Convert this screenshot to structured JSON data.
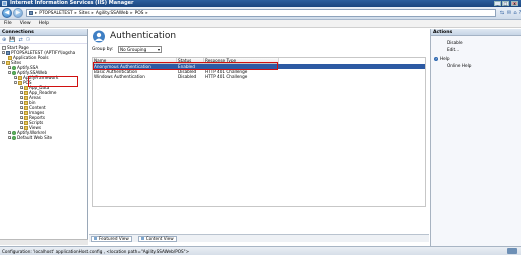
{
  "window": {
    "title": "Internet Information Services (IIS) Manager"
  },
  "window_controls": {
    "minimize": "_",
    "maximize": "□",
    "close": "x"
  },
  "nav": {
    "back": "◀",
    "forward": "▶",
    "breadcrumbs": [
      "PTOPSALETEST",
      "Sites",
      "Agility.SSAWeb",
      "POS"
    ],
    "separator": "▸",
    "tools": [
      "⇆",
      "✉",
      "⌂",
      "?"
    ]
  },
  "menu": [
    "File",
    "View",
    "Help"
  ],
  "connections": {
    "header": "Connections",
    "toolbar": [
      "⊕",
      "💾",
      "⇄",
      "⚆"
    ],
    "tree": [
      {
        "label": "Start Page",
        "icon": "page"
      },
      {
        "label": "PTOPSALETEST (APTIFY\\logsha",
        "icon": "server",
        "exp": "-"
      },
      {
        "label": "Application Pools",
        "icon": "folder"
      },
      {
        "label": "Sites",
        "icon": "folder",
        "exp": "-"
      },
      {
        "label": "Aptify.SSA",
        "icon": "site",
        "exp": "+"
      },
      {
        "label": "Aptify.SSAWeb",
        "icon": "site",
        "exp": "-"
      },
      {
        "label": "AptifyFramework",
        "icon": "folder",
        "exp": "+"
      },
      {
        "label": "POS",
        "icon": "folder",
        "exp": "-"
      },
      {
        "label": "App_Data",
        "icon": "folder",
        "exp": "+"
      },
      {
        "label": "App_Readme",
        "icon": "folder",
        "exp": "+"
      },
      {
        "label": "Areas",
        "icon": "folder",
        "exp": "+"
      },
      {
        "label": "bin",
        "icon": "folder",
        "exp": "+"
      },
      {
        "label": "Content",
        "icon": "folder",
        "exp": "+"
      },
      {
        "label": "Images",
        "icon": "folder",
        "exp": "+"
      },
      {
        "label": "Reports",
        "icon": "folder",
        "exp": "+"
      },
      {
        "label": "Scripts",
        "icon": "folder",
        "exp": "+"
      },
      {
        "label": "Views",
        "icon": "folder",
        "exp": "+"
      },
      {
        "label": "Aptify.Workrel",
        "icon": "site",
        "exp": "+"
      },
      {
        "label": "Default Web Site",
        "icon": "site",
        "exp": "+"
      }
    ]
  },
  "feature": {
    "title": "Authentication"
  },
  "group": {
    "label": "Group by:",
    "value": "No Grouping",
    "arrow": "▾"
  },
  "grid": {
    "columns": [
      "Name",
      "Status",
      "Response Type"
    ],
    "rows": [
      {
        "name": "Anonymous Authentication",
        "status": "Enabled",
        "response": ""
      },
      {
        "name": "Basic Authentication",
        "status": "Disabled",
        "response": "HTTP 401 Challenge"
      },
      {
        "name": "Windows Authentication",
        "status": "Disabled",
        "response": "HTTP 401 Challenge"
      }
    ]
  },
  "views": {
    "features": "Featured View",
    "content": "Content View"
  },
  "actions": {
    "header": "Actions",
    "items": [
      "Disable",
      "Edit...",
      "Help",
      "Online Help"
    ]
  },
  "status": {
    "text": "Configuration: 'localhost' applicationHost.config , <location path=\"Agility.SSAWeb/POS\">"
  },
  "colors": {
    "selection": "#2d5aa3",
    "highlight_box": "#d01010"
  }
}
